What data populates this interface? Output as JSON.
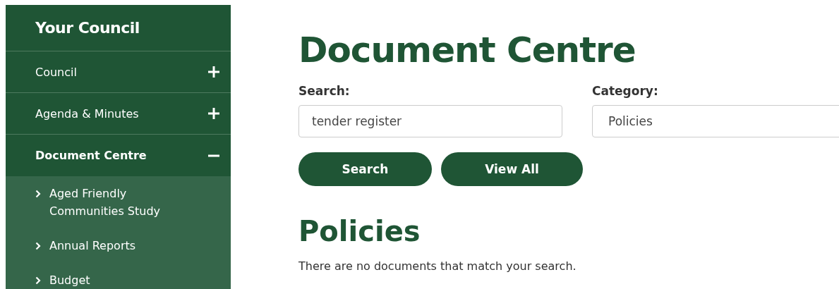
{
  "sidebar": {
    "title": "Your Council",
    "items": [
      {
        "label": "Council",
        "expanded": false
      },
      {
        "label": "Agenda & Minutes",
        "expanded": false
      },
      {
        "label": "Document Centre",
        "expanded": true,
        "children": [
          {
            "label": "Aged Friendly Communities Study"
          },
          {
            "label": "Annual Reports"
          },
          {
            "label": "Budget"
          }
        ]
      }
    ]
  },
  "main": {
    "title": "Document Centre",
    "search": {
      "label": "Search:",
      "value": "tender register"
    },
    "category": {
      "label": "Category:",
      "value": "Policies"
    },
    "buttons": [
      "Search",
      "View All"
    ],
    "results": {
      "title": "Policies",
      "message": "There are no documents that match your search."
    }
  }
}
